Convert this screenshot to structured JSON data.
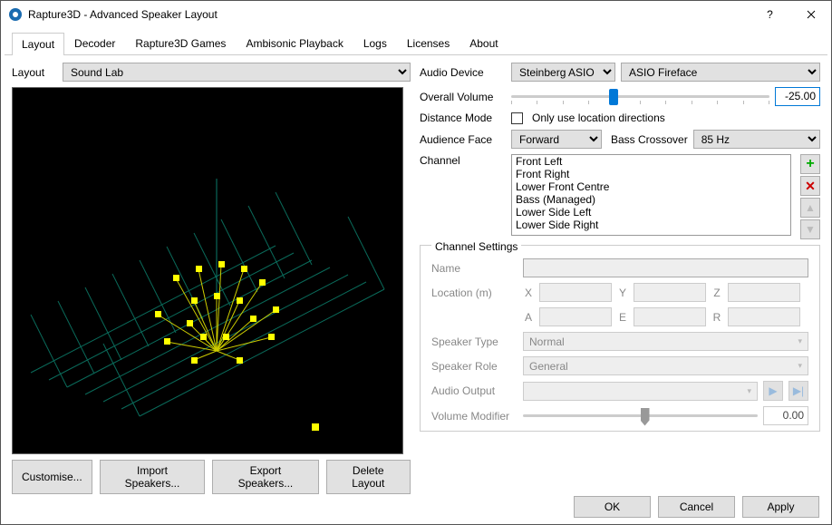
{
  "window": {
    "title": "Rapture3D - Advanced Speaker Layout"
  },
  "tabs": [
    "Layout",
    "Decoder",
    "Rapture3D Games",
    "Ambisonic Playback",
    "Logs",
    "Licenses",
    "About"
  ],
  "active_tab": 0,
  "layout_label": "Layout",
  "layout_value": "Sound Lab",
  "left_buttons": {
    "customise": "Customise...",
    "import": "Import Speakers...",
    "export": "Export Speakers...",
    "delete": "Delete Layout"
  },
  "right": {
    "audio_device_label": "Audio Device",
    "audio_device_driver": "Steinberg ASIO",
    "audio_device_name": "ASIO Fireface",
    "overall_volume_label": "Overall Volume",
    "overall_volume_value": "-25.00",
    "overall_volume_slider_pct": 38,
    "distance_mode_label": "Distance Mode",
    "distance_mode_checkbox": "Only use location directions",
    "audience_face_label": "Audience Face",
    "audience_face_value": "Forward",
    "bass_crossover_label": "Bass Crossover",
    "bass_crossover_value": "85 Hz",
    "channel_label": "Channel",
    "channels": [
      "Front Left",
      "Front Right",
      "Lower Front Centre",
      "Bass (Managed)",
      "Lower Side Left",
      "Lower Side Right"
    ]
  },
  "channel_settings": {
    "legend": "Channel Settings",
    "name_label": "Name",
    "location_label": "Location (m)",
    "axes1": [
      "X",
      "Y",
      "Z"
    ],
    "axes2": [
      "A",
      "E",
      "R"
    ],
    "speaker_type_label": "Speaker Type",
    "speaker_type_value": "Normal",
    "speaker_role_label": "Speaker Role",
    "speaker_role_value": "General",
    "audio_output_label": "Audio Output",
    "volume_modifier_label": "Volume Modifier",
    "volume_modifier_value": "0.00",
    "volume_modifier_slider_pct": 50
  },
  "footer": {
    "ok": "OK",
    "cancel": "Cancel",
    "apply": "Apply"
  }
}
